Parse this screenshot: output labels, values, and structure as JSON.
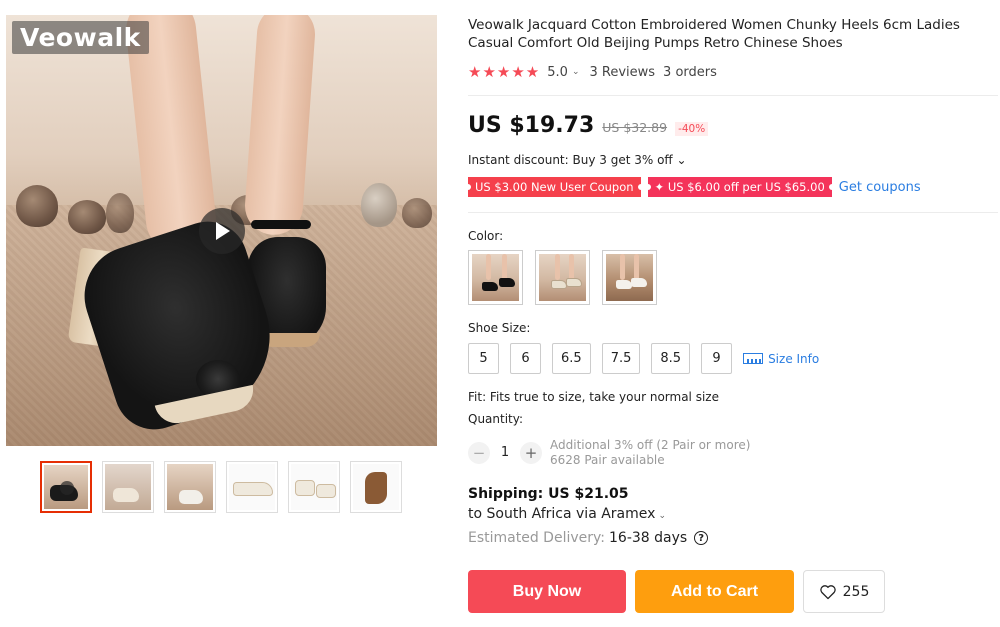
{
  "gallery": {
    "brand_logo": "Veowalk",
    "main_image": "black embroidered chunky heel pump",
    "play_icon": "play-icon",
    "thumbnails": [
      {
        "name": "black shoe with video"
      },
      {
        "name": "beige shoe"
      },
      {
        "name": "white shoe side"
      },
      {
        "name": "white shoe pair"
      },
      {
        "name": "white shoe pair alt"
      },
      {
        "name": "white shoe sole detail"
      }
    ],
    "active_thumb": 0
  },
  "product": {
    "title": "Veowalk Jacquard Cotton Embroidered Women Chunky Heels 6cm Ladies Casual Comfort Old Beijing Pumps Retro Chinese Shoes",
    "stars": "★★★★★",
    "rating": "5.0",
    "rating_chevron": "⌄",
    "reviews": "3 Reviews",
    "orders": "3 orders"
  },
  "pricing": {
    "price": "US $19.73",
    "old_price": "US $32.89",
    "discount": "-40%",
    "instant_discount": "Instant discount: Buy 3 get 3% off ⌄",
    "coupon_1": "US $3.00 New User Coupon",
    "coupon_2": "✦ US $6.00 off per US $65.00",
    "get_coupons": "Get coupons"
  },
  "options": {
    "color_label": "Color:",
    "colors": [
      {
        "name": "black"
      },
      {
        "name": "beige"
      },
      {
        "name": "white"
      }
    ],
    "size_label": "Shoe Size:",
    "sizes": [
      "5",
      "6",
      "6.5",
      "7.5",
      "8.5",
      "9"
    ],
    "size_info": "Size Info",
    "fit": "Fit: Fits true to size, take your normal size"
  },
  "quantity": {
    "label": "Quantity:",
    "minus": "−",
    "plus": "+",
    "value": "1",
    "note_1": "Additional 3% off (2 Pair or more)",
    "note_2": "6628 Pair available"
  },
  "shipping": {
    "title": "Shipping: US $21.05",
    "destination": "to South Africa via Aramex",
    "destination_chevron": "⌄",
    "delivery_label": "Estimated Delivery:",
    "delivery_days": "16-38 days",
    "help_glyph": "?"
  },
  "actions": {
    "buy_now": "Buy Now",
    "add_to_cart": "Add to Cart",
    "wishlist_count": "255"
  },
  "colors": {
    "accent_red": "#f54a56",
    "cart_orange": "#fe9e0e",
    "link_blue": "#2a7de1"
  }
}
